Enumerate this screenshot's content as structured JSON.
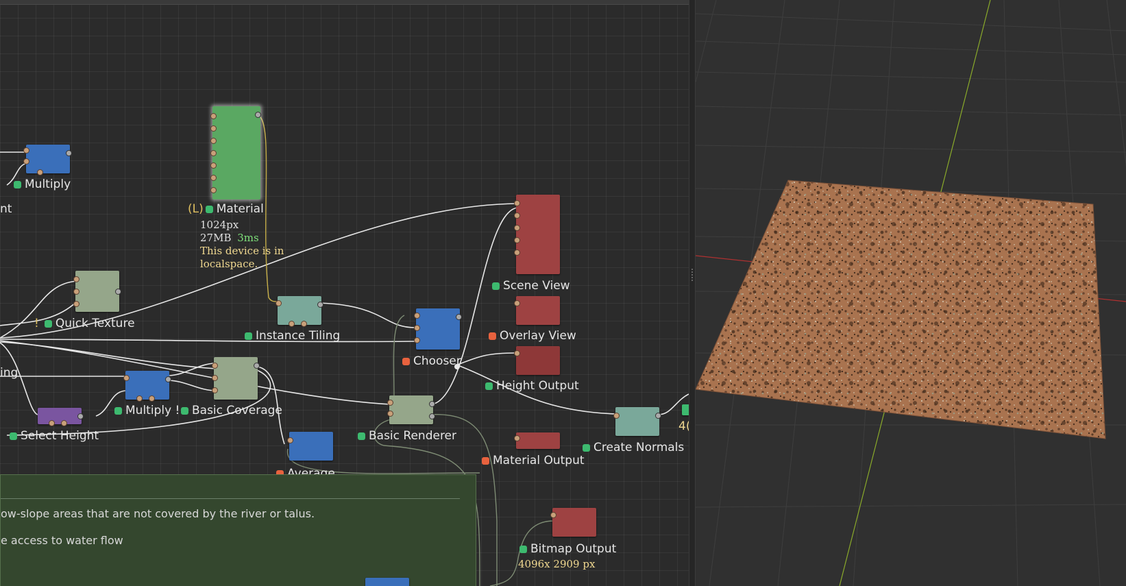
{
  "graph": {
    "nodes": {
      "multiply_top": {
        "label": "Multiply",
        "status": "green"
      },
      "partial_left_top": {
        "label": "nt"
      },
      "material": {
        "prefix": "(L)",
        "label": "Material",
        "status": "green",
        "resolution": "1024px",
        "memory": "27MB",
        "time": "3ms",
        "note_line1": "This device is in",
        "note_line2": "localspace."
      },
      "quick_texture": {
        "prefix": "!",
        "label": "Quick Texture",
        "status": "green"
      },
      "instance_tiling": {
        "label": "Instance Tiling",
        "status": "green"
      },
      "scene_view": {
        "label": "Scene View",
        "status": "green"
      },
      "overlay_view": {
        "label": "Overlay View",
        "status": "orange"
      },
      "chooser": {
        "label": "Chooser",
        "status": "orange"
      },
      "height_output": {
        "label": "Height Output",
        "status": "green"
      },
      "partial_left_mid": {
        "label": "ing"
      },
      "multiply_mid": {
        "label": "Multiply !",
        "status": "green"
      },
      "basic_coverage": {
        "label": "Basic Coverage",
        "status": "green"
      },
      "select_height": {
        "label": "Select Height",
        "status": "green"
      },
      "basic_renderer": {
        "label": "Basic Renderer",
        "status": "green"
      },
      "create_normals": {
        "label": "Create Normals",
        "status": "green"
      },
      "partial_right": {
        "label": "4("
      },
      "average": {
        "label": "Average",
        "status": "orange"
      },
      "material_output": {
        "label": "Material Output",
        "status": "orange"
      },
      "bitmap_output": {
        "label": "Bitmap Output",
        "status": "green",
        "size": "4096x 2909 px"
      }
    },
    "comment_frame": {
      "line1": "ow-slope areas that are not covered by the river or talus.",
      "line2": "e access to water flow"
    }
  },
  "colors": {
    "node_blue": "#3a6fba",
    "node_green": "#5aa862",
    "node_sage": "#95a68a",
    "node_teal": "#7aa89a",
    "node_red": "#9e4242",
    "node_purple": "#7a55a0",
    "status_green": "#3dba6f",
    "status_orange": "#e8623e",
    "info_yellow": "#f0d890",
    "info_green": "#7ee07a"
  }
}
